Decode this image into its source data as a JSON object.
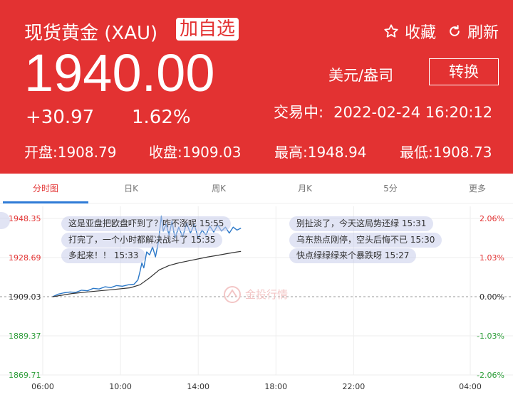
{
  "header": {
    "title": "现货黄金 (XAU)",
    "add_fav_label": "加自选",
    "favorite_label": "收藏",
    "refresh_label": "刷新",
    "price": "1940.00",
    "change": "+30.97",
    "change_pct": "1.62%",
    "unit": "美元/盎司",
    "convert_label": "转换",
    "status_label": "交易中:",
    "datetime": "2022-02-24 16:20:12",
    "open": "开盘:1908.79",
    "close": "收盘:1909.03",
    "high": "最高:1948.94",
    "low": "最低:1908.73"
  },
  "tabs": [
    {
      "label": "分时图",
      "active": true
    },
    {
      "label": "日K",
      "active": false
    },
    {
      "label": "周K",
      "active": false
    },
    {
      "label": "月K",
      "active": false
    },
    {
      "label": "5分",
      "active": false
    },
    {
      "label": "更多",
      "active": false
    }
  ],
  "comments": [
    "这是亚盘把欧盘吓到了？咋不涨呢 15:55",
    "打完了，一个小时都解决战斗了 15:35",
    "多起来！！ 15:33",
    "别扯淡了，今天这局势还绿 15:31",
    "乌东热点刚停，空头后悔不已 15:30",
    "快点绿绿绿来个暴跌呀 15:27"
  ],
  "watermark": "金投行情",
  "chart_data": {
    "type": "line",
    "x_ticks": [
      "06:00",
      "10:00",
      "14:00",
      "18:00",
      "22:00",
      "04:00"
    ],
    "y_ticks": [
      "1948.35",
      "1928.69",
      "1909.03",
      "1889.37",
      "1869.71"
    ],
    "y_pct_ticks": [
      "2.06%",
      "1.03%",
      "0.00%",
      "-1.03%",
      "-2.06%"
    ],
    "ylim": [
      1869.71,
      1948.35
    ],
    "xlim_hours": [
      6,
      28
    ],
    "base": 1909.03,
    "colors": {
      "price": "#2b78c8",
      "average": "#333333",
      "up": "#e33232",
      "down": "#2e9e3a"
    },
    "series": [
      {
        "kind": "price",
        "points": [
          [
            6.5,
            1909.0
          ],
          [
            6.8,
            1910.3
          ],
          [
            7.1,
            1911.0
          ],
          [
            7.4,
            1911.4
          ],
          [
            7.7,
            1911.2
          ],
          [
            8.0,
            1912.3
          ],
          [
            8.3,
            1912.0
          ],
          [
            8.6,
            1913.2
          ],
          [
            8.9,
            1912.9
          ],
          [
            9.2,
            1914.0
          ],
          [
            9.5,
            1913.6
          ],
          [
            9.8,
            1914.6
          ],
          [
            10.1,
            1914.3
          ],
          [
            10.4,
            1915.0
          ],
          [
            10.7,
            1915.3
          ],
          [
            10.9,
            1917.5
          ],
          [
            11.0,
            1921.5
          ],
          [
            11.1,
            1926.0
          ],
          [
            11.2,
            1923.5
          ],
          [
            11.35,
            1931.5
          ],
          [
            11.5,
            1930.0
          ],
          [
            11.65,
            1934.0
          ],
          [
            11.8,
            1929.0
          ],
          [
            11.95,
            1936.5
          ],
          [
            12.1,
            1949.5
          ],
          [
            12.2,
            1942.0
          ],
          [
            12.35,
            1945.5
          ],
          [
            12.5,
            1940.0
          ],
          [
            12.65,
            1947.0
          ],
          [
            12.8,
            1938.5
          ],
          [
            13.0,
            1944.0
          ],
          [
            13.2,
            1939.0
          ],
          [
            13.4,
            1946.0
          ],
          [
            13.6,
            1941.0
          ],
          [
            13.8,
            1945.5
          ],
          [
            14.0,
            1938.5
          ],
          [
            14.2,
            1942.5
          ],
          [
            14.4,
            1940.0
          ],
          [
            14.6,
            1944.5
          ],
          [
            14.8,
            1941.5
          ],
          [
            15.0,
            1945.0
          ],
          [
            15.2,
            1942.0
          ],
          [
            15.4,
            1944.0
          ],
          [
            15.6,
            1941.0
          ],
          [
            15.8,
            1944.0
          ],
          [
            16.0,
            1942.5
          ],
          [
            16.2,
            1943.5
          ]
        ]
      },
      {
        "kind": "average",
        "points": [
          [
            6.5,
            1909.0
          ],
          [
            7.5,
            1910.6
          ],
          [
            8.5,
            1911.6
          ],
          [
            9.5,
            1912.5
          ],
          [
            10.5,
            1913.5
          ],
          [
            11.0,
            1915.0
          ],
          [
            11.5,
            1918.5
          ],
          [
            12.0,
            1922.5
          ],
          [
            12.5,
            1924.7
          ],
          [
            13.0,
            1926.0
          ],
          [
            13.5,
            1927.0
          ],
          [
            14.0,
            1928.0
          ],
          [
            14.5,
            1929.0
          ],
          [
            15.0,
            1929.8
          ],
          [
            15.5,
            1930.7
          ],
          [
            16.0,
            1931.5
          ],
          [
            16.2,
            1931.8
          ]
        ]
      }
    ]
  }
}
